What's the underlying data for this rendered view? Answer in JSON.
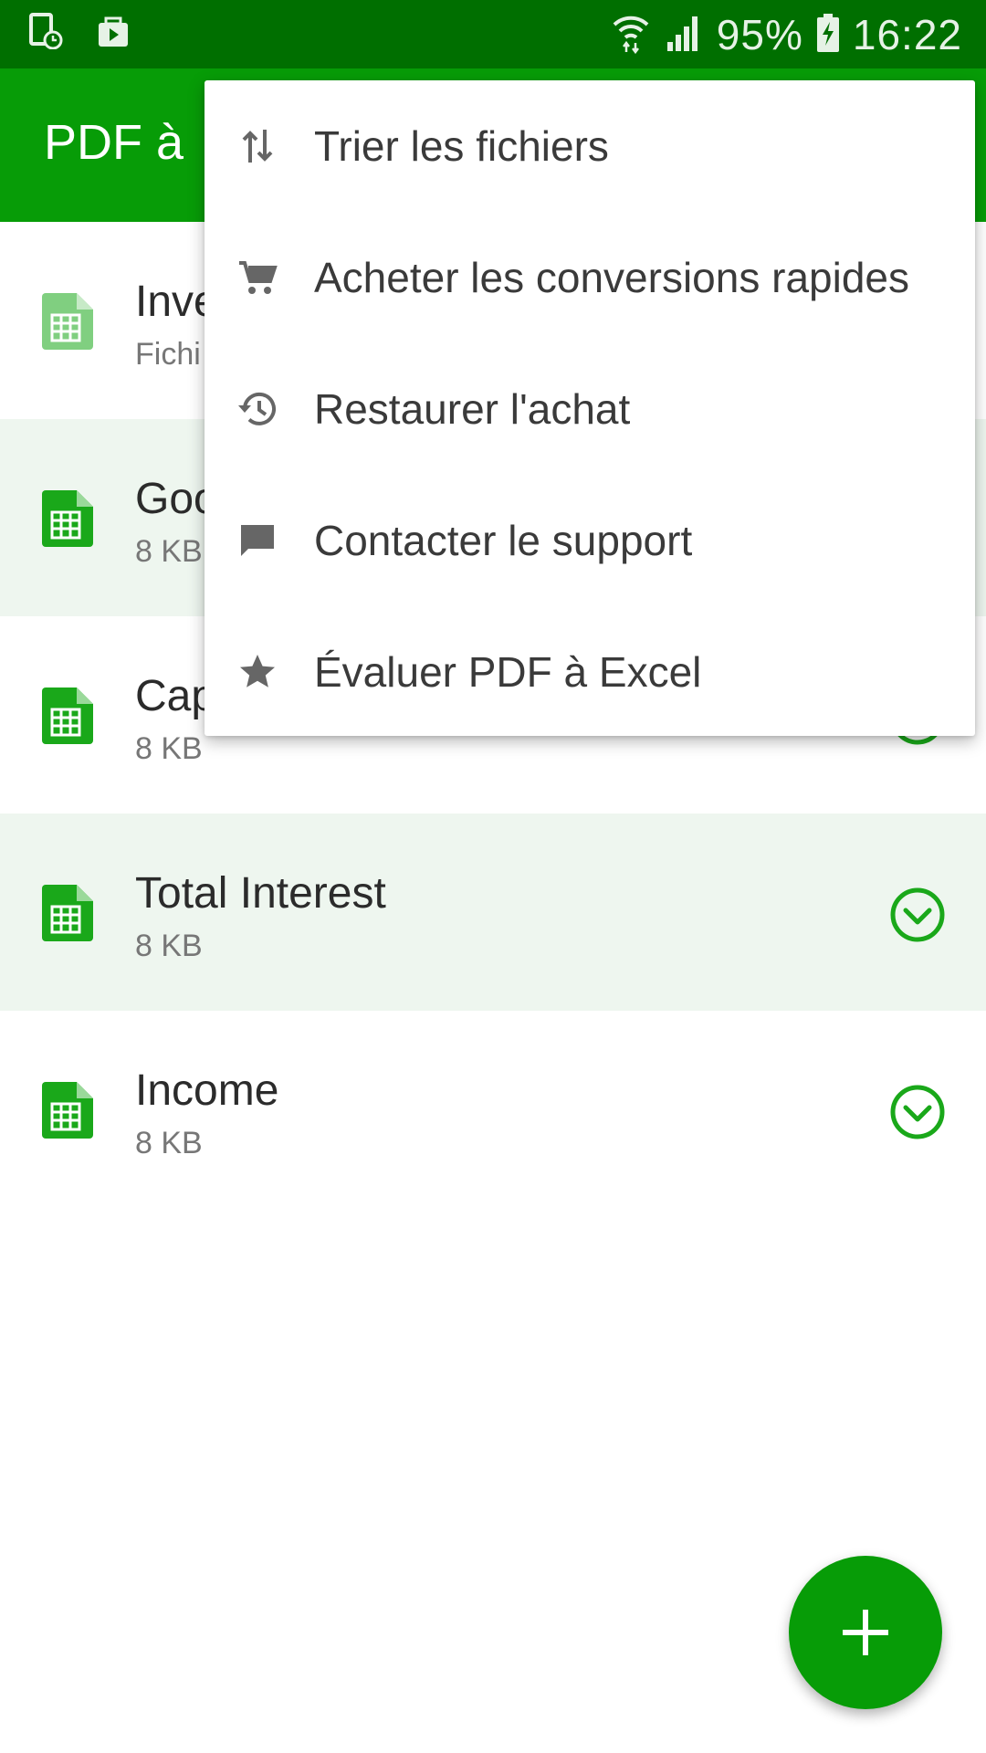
{
  "status_bar": {
    "battery": "95%",
    "time": "16:22",
    "icons": [
      "notification-clock-icon",
      "play-store-icon",
      "wifi-icon",
      "signal-icon",
      "battery-charging-icon"
    ]
  },
  "app_bar": {
    "title": "PDF à"
  },
  "files": [
    {
      "name": "Inve",
      "meta": "Fichi",
      "icon": "spreadsheet-icon",
      "status": "pending"
    },
    {
      "name": "Goo",
      "meta": "8 KB",
      "icon": "spreadsheet-icon",
      "status": "done"
    },
    {
      "name": "Cap",
      "meta": "8 KB",
      "icon": "spreadsheet-icon",
      "status": "done"
    },
    {
      "name": "Total Interest",
      "meta": "8 KB",
      "icon": "spreadsheet-icon",
      "status": "done"
    },
    {
      "name": "Income",
      "meta": "8 KB",
      "icon": "spreadsheet-icon",
      "status": "done"
    }
  ],
  "menu": {
    "items": [
      {
        "label": "Trier les fichiers",
        "icon": "sort-icon"
      },
      {
        "label": "Acheter les conversions rapides",
        "icon": "cart-icon"
      },
      {
        "label": "Restaurer l'achat",
        "icon": "restore-icon"
      },
      {
        "label": "Contacter le support",
        "icon": "chat-icon"
      },
      {
        "label": "Évaluer PDF à Excel",
        "icon": "star-icon"
      }
    ]
  },
  "fab": {
    "icon": "plus-icon"
  },
  "colors": {
    "status_bar": "#006f00",
    "app_bar": "#079c07",
    "accent": "#1aa81a",
    "row_alt": "#eef6ef"
  }
}
